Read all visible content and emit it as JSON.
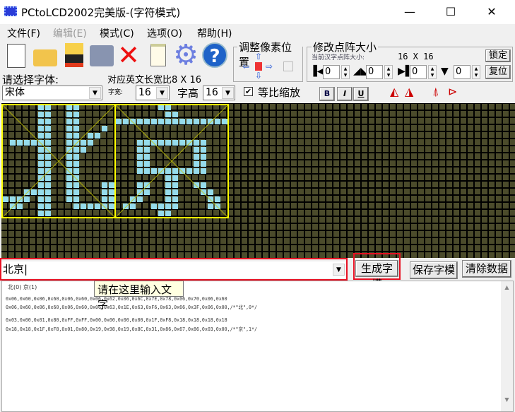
{
  "window": {
    "title": "PCtoLCD2002完美版-(字符模式)",
    "minimize": "—",
    "maximize": "☐",
    "close": "✕"
  },
  "menu": [
    {
      "label": "文件(F)"
    },
    {
      "label": "编辑(E)"
    },
    {
      "label": "模式(C)"
    },
    {
      "label": "选项(O)"
    },
    {
      "label": "帮助(H)"
    }
  ],
  "toolbar": [
    "new-icon",
    "open-icon",
    "save-icon",
    "import-icon",
    "delete-icon",
    "notepad-icon",
    "settings-icon",
    "help-icon"
  ],
  "pixel_adjust": {
    "title": "调整像素位置"
  },
  "matrix_size": {
    "title": "修改点阵大小",
    "current_label": "当前汉字点阵大小:",
    "current_value": "16 X 16",
    "lock": "锁定",
    "reset": "复位",
    "spins": [
      "0",
      "0",
      "0",
      "0"
    ]
  },
  "font": {
    "label": "请选择字体:",
    "value": "宋体",
    "ratio": "对应英文长宽比8 X 16",
    "width_label": "字宽:",
    "width": "16",
    "height_label": "字高",
    "height": "16",
    "proportional": "等比缩放",
    "proportional_checked": true,
    "bold": "B",
    "italic": "I",
    "underline": "U"
  },
  "glyphs": [
    {
      "char": "北",
      "rows": [
        "0660",
        "0660",
        "0660",
        "0662",
        "066C",
        "7E78",
        "0670",
        "0660",
        "0660",
        "0660",
        "0660",
        "0663",
        "1E63",
        "F663",
        "663F",
        "0600"
      ]
    },
    {
      "char": "京",
      "rows": [
        "0300",
        "0180",
        "FFFF",
        "0000",
        "0000",
        "1FF8",
        "1818",
        "1818",
        "1818",
        "1FF8",
        "0180",
        "1998",
        "198C",
        "3186",
        "6786",
        "0300"
      ]
    }
  ],
  "input": {
    "value": "北京",
    "tooltip": "请在这里输入文字"
  },
  "buttons": {
    "generate": "生成字模",
    "save": "保存字模",
    "clear": "清除数据"
  },
  "output": {
    "index": "北(0) 京(1)",
    "lines": [
      "0x06,0x60,0x06,0x60,0x06,0x60,0x06,0x62,0x06,0x6C,0x7E,0x78,0x06,0x70,0x06,0x60",
      "0x06,0x60,0x06,0x60,0x06,0x60,0x06,0x63,0x1E,0x63,0xF6,0x63,0x66,0x3F,0x06,0x00,/*\"北\",0*/",
      "",
      "0x03,0x00,0x01,0x80,0xFF,0xFF,0x00,0x00,0x00,0x00,0x1F,0xF8,0x18,0x18,0x18,0x18",
      "0x18,0x18,0x1F,0xF8,0x01,0x80,0x19,0x98,0x19,0x8C,0x31,0x86,0x67,0x86,0x03,0x00,/*\"京\",1*/"
    ]
  },
  "colors": {
    "pixel_on": "#96dcec",
    "pixel_off": "#4b4b2b",
    "frame": "#ffff00",
    "highlight": "#e81123"
  }
}
